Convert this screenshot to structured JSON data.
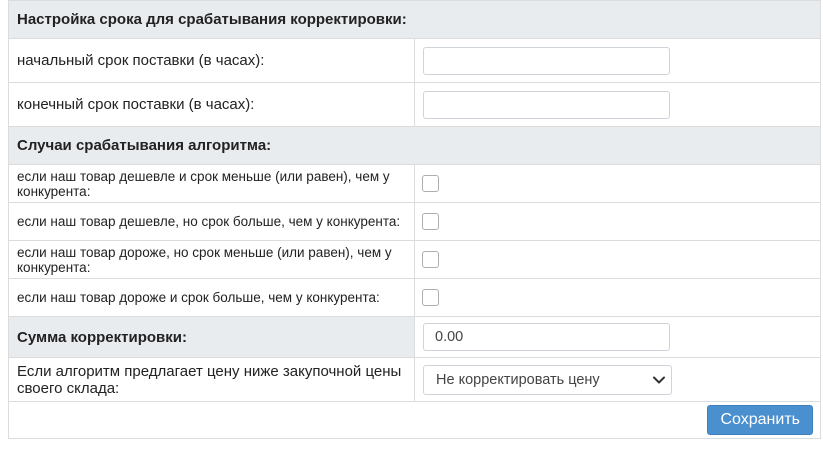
{
  "sections": {
    "term": "Настройка срока для срабатывания корректировки:",
    "cases": "Случаи срабатывания алгоритма:",
    "amount": "Сумма корректировки:"
  },
  "fields": {
    "start_term_label": "начальный срок поставки (в часах):",
    "start_term_value": "",
    "end_term_label": "конечный срок поставки (в часах):",
    "end_term_value": "",
    "amount_value": "0.00",
    "below_purchase_label": "Если алгоритм предлагает цену ниже закупочной цены своего склада:",
    "below_purchase_selected": "Не корректировать цену"
  },
  "cases": [
    {
      "label": "если наш товар дешевле и срок меньше (или равен), чем у конкурента:",
      "checked": false
    },
    {
      "label": "если наш товар дешевле, но срок больше, чем у конкурента:",
      "checked": false
    },
    {
      "label": "если наш товар дороже, но срок меньше (или равен), чем у конкурента:",
      "checked": false
    },
    {
      "label": "если наш товар дороже и срок больше, чем у конкурента:",
      "checked": false
    }
  ],
  "actions": {
    "save_label": "Сохранить"
  },
  "colors": {
    "section_bg": "#e9ecef",
    "primary_button": "#4a8fce",
    "border": "#dcdcdc"
  }
}
